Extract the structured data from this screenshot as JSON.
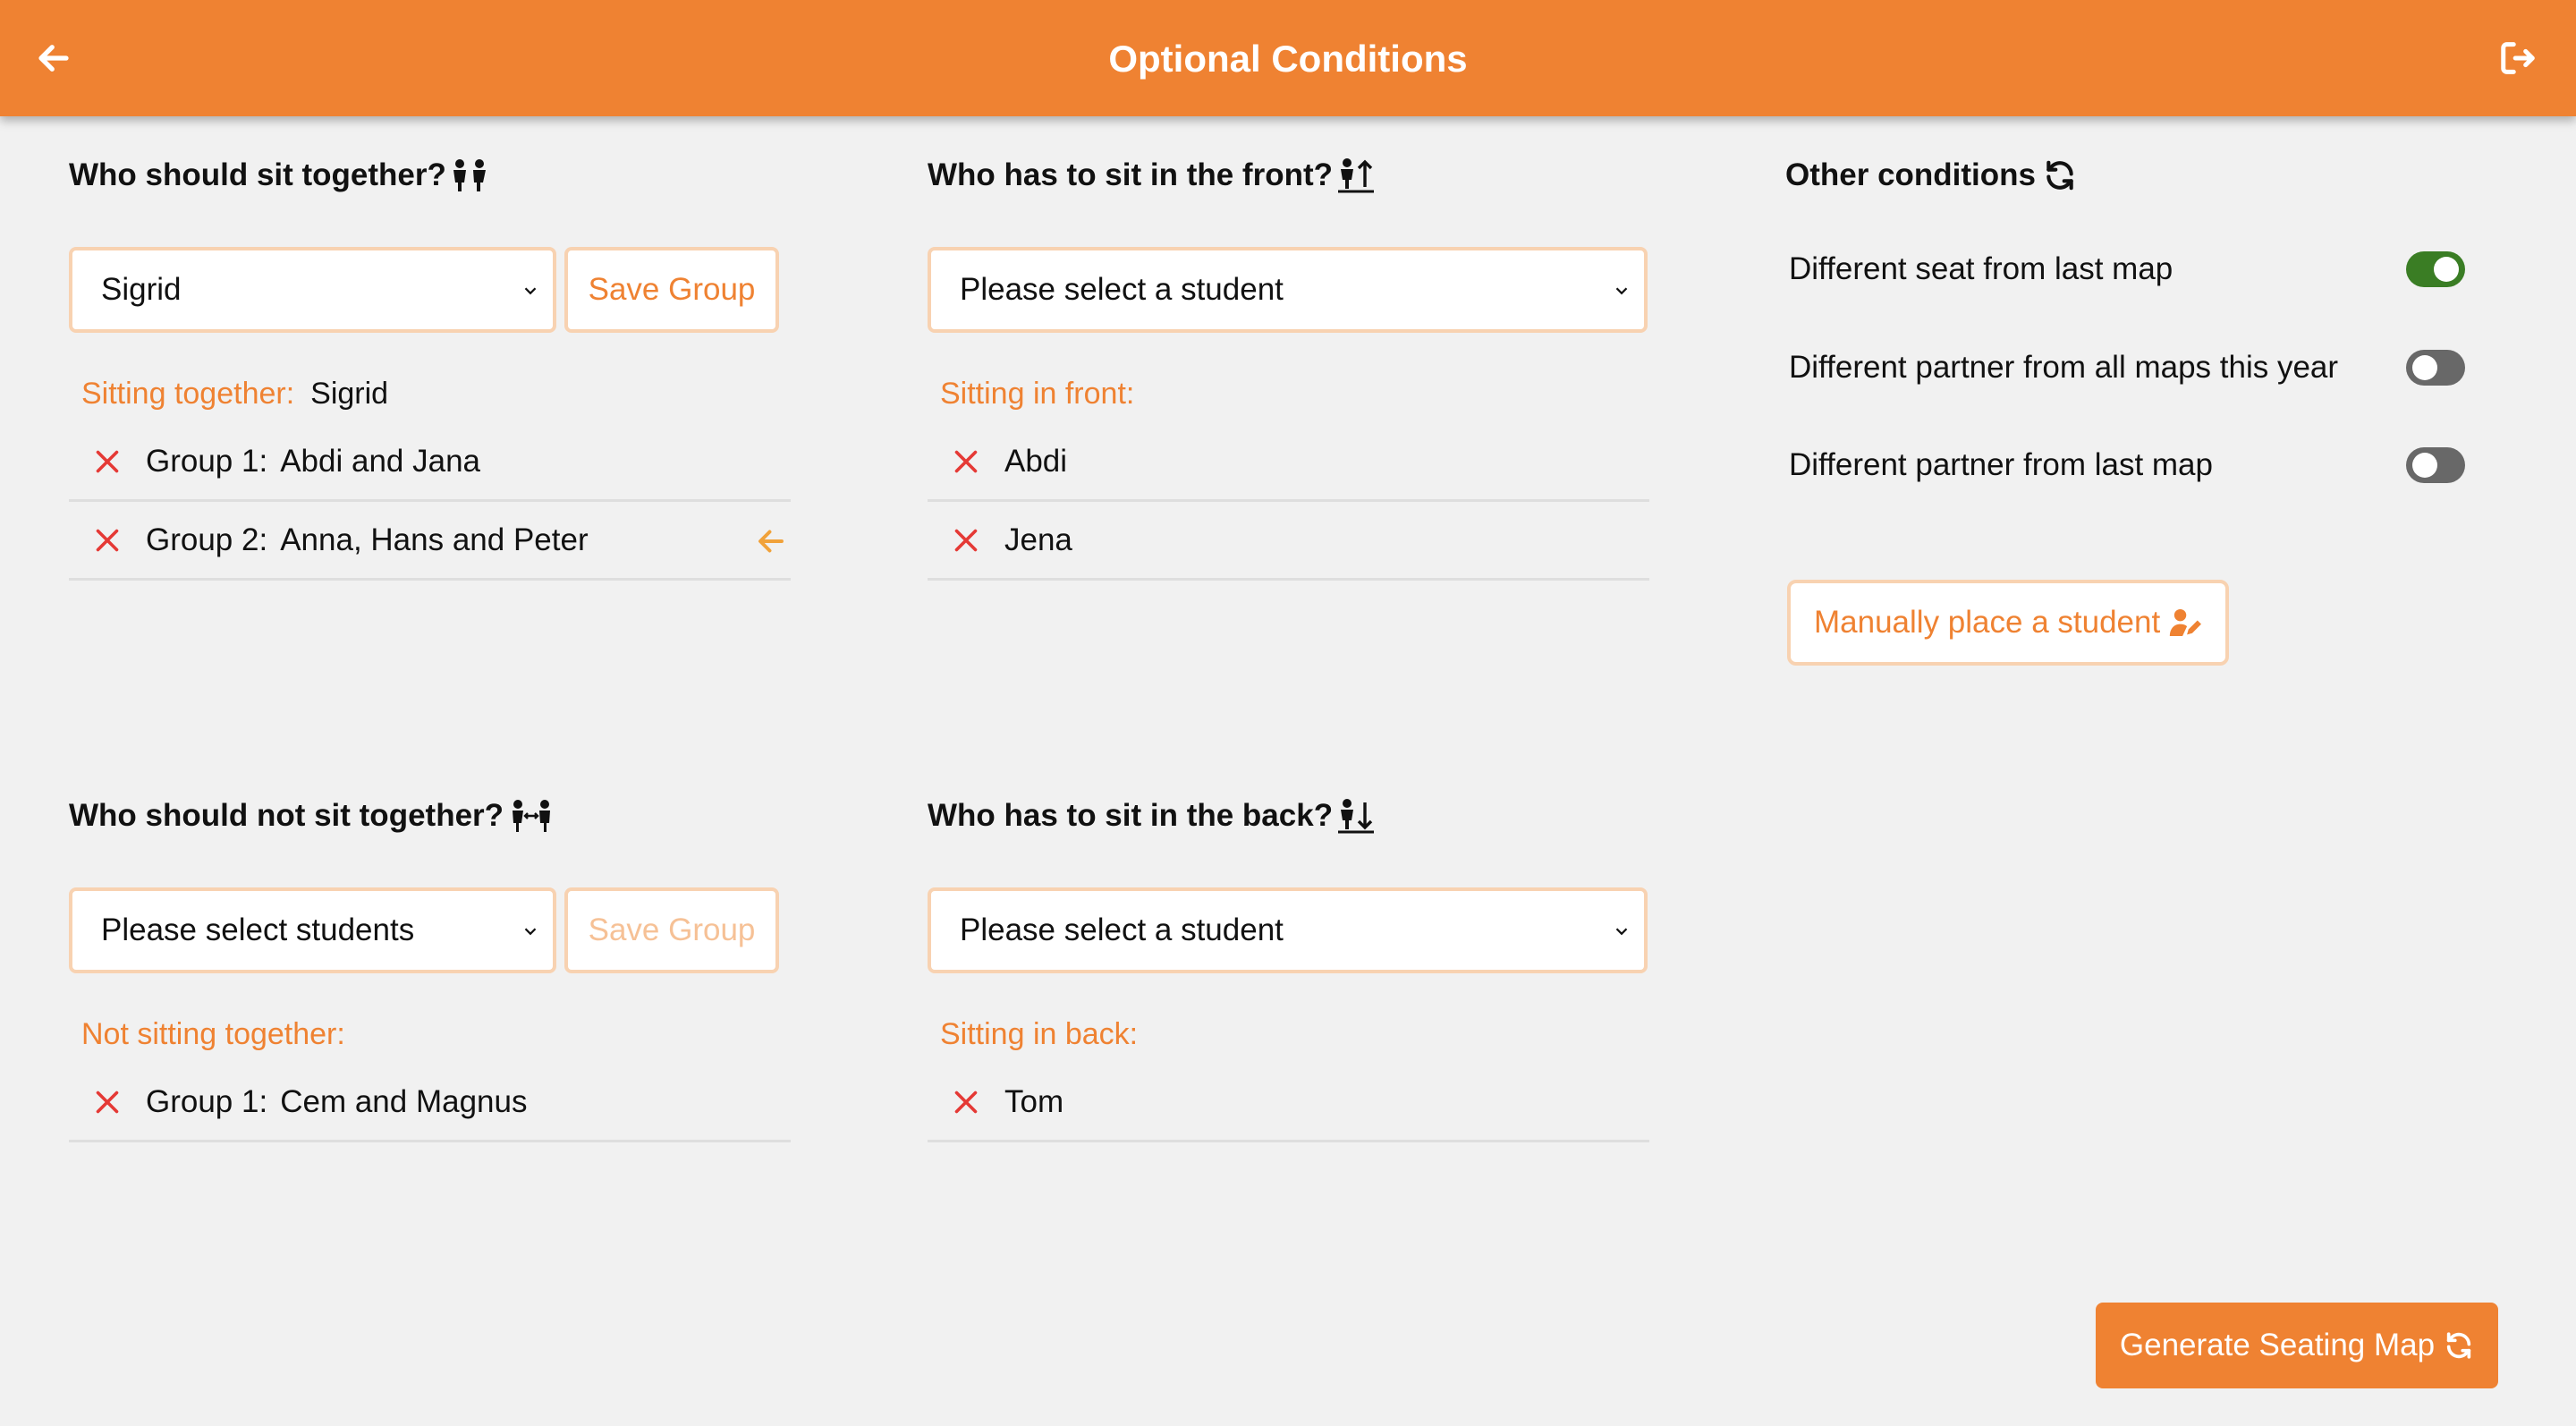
{
  "header": {
    "title": "Optional Conditions",
    "back_icon": "arrow-left-icon",
    "logout_icon": "logout-icon"
  },
  "colors": {
    "accent": "#ef8232",
    "accent_light": "#f8d2b1",
    "remove": "#e53935",
    "toggle_on": "#3a7d24",
    "toggle_off": "#686868"
  },
  "sit_together": {
    "title": "Who should sit together?",
    "icon": "people-together-icon",
    "select_value": "Sigrid",
    "save_label": "Save Group",
    "list_label": "Sitting together:",
    "list_value": "Sigrid",
    "groups": [
      {
        "label": "Group 1:",
        "names": "Abdi and Jana"
      },
      {
        "label": "Group 2:",
        "names": "Anna, Hans and Peter"
      }
    ]
  },
  "sit_front": {
    "title": "Who has to sit in the front?",
    "icon": "person-front-icon",
    "select_value": "Please select a student",
    "list_label": "Sitting in front:",
    "students": [
      "Abdi",
      "Jena"
    ]
  },
  "other_conditions": {
    "title": "Other conditions",
    "icon": "refresh-icon",
    "toggles": [
      {
        "label": "Different seat from last map",
        "on": true
      },
      {
        "label": "Different partner from all maps this year",
        "on": false
      },
      {
        "label": "Different partner from last map",
        "on": false
      }
    ],
    "manual_label": "Manually place a student",
    "manual_icon": "user-edit-icon"
  },
  "not_together": {
    "title": "Who should not sit together?",
    "icon": "people-apart-icon",
    "select_value": "Please select students",
    "save_label": "Save Group",
    "list_label": "Not sitting together:",
    "groups": [
      {
        "label": "Group 1:",
        "names": "Cem and Magnus"
      }
    ]
  },
  "sit_back": {
    "title": "Who has to sit in the back?",
    "icon": "person-back-icon",
    "select_value": "Please select a student",
    "list_label": "Sitting in back:",
    "students": [
      "Tom"
    ]
  },
  "generate": {
    "label": "Generate Seating Map",
    "icon": "regenerate-icon"
  }
}
